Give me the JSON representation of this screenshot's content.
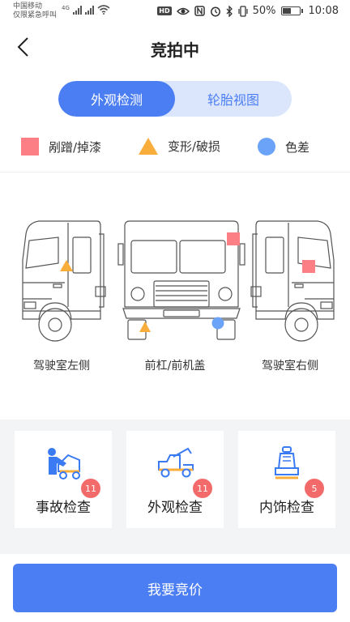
{
  "status_bar": {
    "carrier_line1": "中国移动",
    "carrier_line2": "仅限紧急呼叫",
    "network": "4G",
    "battery_percent": "50%",
    "battery_level": 0.5,
    "time": "10:08",
    "icons": [
      "signal-icon",
      "wifi-icon",
      "hd-icon",
      "eye-icon",
      "nfc-icon",
      "alarm-icon",
      "bluetooth-icon",
      "vibrate-icon",
      "battery-icon"
    ]
  },
  "nav": {
    "title": "竞拍中",
    "back_icon": "chevron-left-icon"
  },
  "tabs": [
    {
      "label": "外观检测",
      "active": true
    },
    {
      "label": "轮胎视图",
      "active": false
    }
  ],
  "legend": [
    {
      "label": "剐蹭/掉漆",
      "shape": "square",
      "color": "#fb7f85"
    },
    {
      "label": "变形/破损",
      "shape": "triangle",
      "color": "#f9ad3b"
    },
    {
      "label": "色差",
      "shape": "circle",
      "color": "#6ba3f8"
    }
  ],
  "views": [
    {
      "label": "驾驶室左侧"
    },
    {
      "label": "前杠/前机盖"
    },
    {
      "label": "驾驶室右侧"
    }
  ],
  "cards": [
    {
      "label": "事故检查",
      "badge": "11",
      "icon": "mechanic-car-icon"
    },
    {
      "label": "外观检查",
      "badge": "11",
      "icon": "tow-truck-icon"
    },
    {
      "label": "内饰检查",
      "badge": "5",
      "icon": "car-seat-icon"
    }
  ],
  "actions": {
    "bid_label": "我要竞价"
  },
  "colors": {
    "accent": "#4c7ef3",
    "tab_bg": "#dbe6fc",
    "badge": "#f26a6a"
  }
}
